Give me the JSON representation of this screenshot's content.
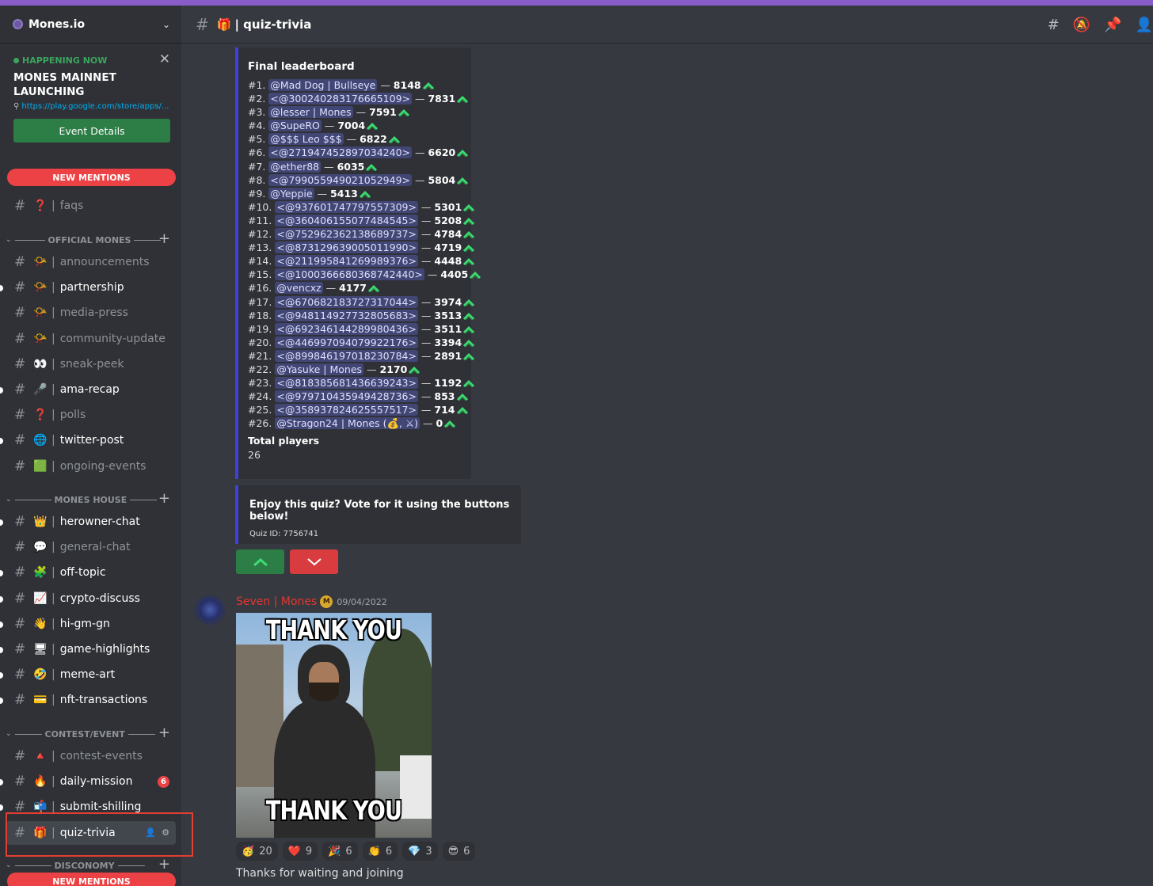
{
  "server": {
    "name": "Mones.io"
  },
  "event": {
    "status": "HAPPENING NOW",
    "title": "MONES MAINNET LAUNCHING",
    "link": "https://play.google.com/store/apps/...",
    "button": "Event Details"
  },
  "sidebar": {
    "new_mentions": "NEW MENTIONS",
    "channels_top": [
      {
        "name": "faqs",
        "emoji": "❓",
        "unread": false
      }
    ],
    "categories": [
      {
        "name": "OFFICIAL MONES"
      },
      {
        "name": "MONES HOUSE"
      },
      {
        "name": "CONTEST/EVENT"
      },
      {
        "name": "DISCONOMY"
      }
    ],
    "official": [
      {
        "name": "announcements",
        "emoji": "📯",
        "unread": false
      },
      {
        "name": "partnership",
        "emoji": "📯",
        "unread": true
      },
      {
        "name": "media-press",
        "emoji": "📯",
        "unread": false
      },
      {
        "name": "community-update",
        "emoji": "📯",
        "unread": false
      },
      {
        "name": "sneak-peek",
        "emoji": "👀",
        "unread": false
      },
      {
        "name": "ama-recap",
        "emoji": "🎤",
        "unread": true
      },
      {
        "name": "polls",
        "emoji": "❓",
        "unread": false
      },
      {
        "name": "twitter-post",
        "emoji": "🌐",
        "unread": true
      },
      {
        "name": "ongoing-events",
        "emoji": "🟩",
        "unread": false
      }
    ],
    "house": [
      {
        "name": "herowner-chat",
        "emoji": "👑",
        "unread": true
      },
      {
        "name": "general-chat",
        "emoji": "💬",
        "unread": false
      },
      {
        "name": "off-topic",
        "emoji": "🧩",
        "unread": true
      },
      {
        "name": "crypto-discuss",
        "emoji": "📈",
        "unread": true
      },
      {
        "name": "hi-gm-gn",
        "emoji": "👋",
        "unread": true
      },
      {
        "name": "game-highlights",
        "emoji": "🖥",
        "unread": true
      },
      {
        "name": "meme-art",
        "emoji": "🤣",
        "unread": true
      },
      {
        "name": "nft-transactions",
        "emoji": "💳",
        "unread": true
      }
    ],
    "contest": [
      {
        "name": "contest-events",
        "emoji": "🔺",
        "unread": false
      },
      {
        "name": "daily-mission",
        "emoji": "🔥",
        "unread": true,
        "badge": "6"
      },
      {
        "name": "submit-shilling",
        "emoji": "📬",
        "unread": true
      },
      {
        "name": "quiz-trivia",
        "emoji": "🎁",
        "unread": false,
        "active": true
      }
    ]
  },
  "header": {
    "channel": "quiz-trivia",
    "emoji": "🎁"
  },
  "leaderboard": {
    "title": "Final leaderboard",
    "rows": [
      {
        "rank": "#1.",
        "user": "@Mad Dog | Bullseye",
        "score": "8148"
      },
      {
        "rank": "#2.",
        "user": "<@300240283176665109>",
        "score": "7831"
      },
      {
        "rank": "#3.",
        "user": "@lesser | Mones",
        "score": "7591"
      },
      {
        "rank": "#4.",
        "user": "@SupeRO",
        "score": "7004"
      },
      {
        "rank": "#5.",
        "user": "@$$$ Leo $$$",
        "score": "6822"
      },
      {
        "rank": "#6.",
        "user": "<@271947452897034240>",
        "score": "6620"
      },
      {
        "rank": "#7.",
        "user": "@ether88",
        "score": "6035"
      },
      {
        "rank": "#8.",
        "user": "<@799055949021052949>",
        "score": "5804"
      },
      {
        "rank": "#9.",
        "user": "@Yeppie",
        "score": "5413"
      },
      {
        "rank": "#10.",
        "user": "<@937601747797557309>",
        "score": "5301"
      },
      {
        "rank": "#11.",
        "user": "<@360406155077484545>",
        "score": "5208"
      },
      {
        "rank": "#12.",
        "user": "<@752962362138689737>",
        "score": "4784"
      },
      {
        "rank": "#13.",
        "user": "<@873129639005011990>",
        "score": "4719"
      },
      {
        "rank": "#14.",
        "user": "<@211995841269989376>",
        "score": "4448"
      },
      {
        "rank": "#15.",
        "user": "<@1000366680368742440>",
        "score": "4405"
      },
      {
        "rank": "#16.",
        "user": "@vencxz",
        "score": "4177"
      },
      {
        "rank": "#17.",
        "user": "<@670682183727317044>",
        "score": "3974"
      },
      {
        "rank": "#18.",
        "user": "<@948114927732805683>",
        "score": "3513"
      },
      {
        "rank": "#19.",
        "user": "<@692346144289980436>",
        "score": "3511"
      },
      {
        "rank": "#20.",
        "user": "<@446997094079922176>",
        "score": "3394"
      },
      {
        "rank": "#21.",
        "user": "<@899846197018230784>",
        "score": "2891"
      },
      {
        "rank": "#22.",
        "user": "@Yasuke | Mones",
        "score": "2170"
      },
      {
        "rank": "#23.",
        "user": "<@818385681436639243>",
        "score": "1192"
      },
      {
        "rank": "#24.",
        "user": "<@979710435949428736>",
        "score": "853"
      },
      {
        "rank": "#25.",
        "user": "<@358937824625557517>",
        "score": "714"
      },
      {
        "rank": "#26.",
        "user": "@Stragon24 | Mones (💰, ⚔)",
        "score": "0"
      }
    ],
    "total_label": "Total players",
    "total_value": "26"
  },
  "vote": {
    "title": "Enjoy this quiz? Vote for it using the buttons below!",
    "quiz_id": "Quiz ID: 7756741"
  },
  "message": {
    "author": "Seven | Mones",
    "timestamp": "09/04/2022",
    "meme_top": "THANK YOU",
    "meme_bottom": "THANK YOU",
    "reactions": [
      {
        "emoji": "🥳",
        "count": "20"
      },
      {
        "emoji": "❤️",
        "count": "9"
      },
      {
        "emoji": "🎉",
        "count": "6"
      },
      {
        "emoji": "👏",
        "count": "6"
      },
      {
        "emoji": "💎",
        "count": "3"
      },
      {
        "emoji": "😎",
        "count": "6"
      }
    ],
    "text": "Thanks for waiting and joining"
  },
  "colors": {
    "accent": "#3c44d8",
    "danger": "#ed4245",
    "success": "#2d7d46",
    "author": "#e8352f"
  }
}
